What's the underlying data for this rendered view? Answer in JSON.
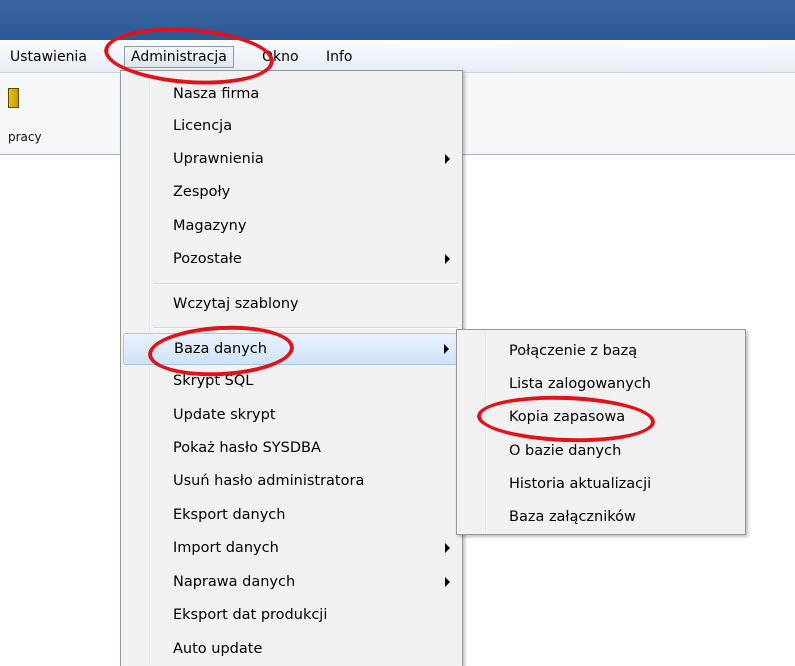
{
  "menubar": {
    "items": [
      {
        "label": "Ustawienia"
      },
      {
        "label": "Administracja"
      },
      {
        "label": "Okno"
      },
      {
        "label": "Info"
      }
    ]
  },
  "toolbar": {
    "item_label": "pracy"
  },
  "admin_menu": {
    "items": [
      {
        "label": "Nasza firma",
        "submenu": false
      },
      {
        "label": "Licencja",
        "submenu": false
      },
      {
        "label": "Uprawnienia",
        "submenu": true
      },
      {
        "label": "Zespoły",
        "submenu": false
      },
      {
        "label": "Magazyny",
        "submenu": false
      },
      {
        "label": "Pozostałe",
        "submenu": true
      },
      {
        "label": "Wczytaj szablony",
        "submenu": false
      },
      {
        "label": "Baza danych",
        "submenu": true,
        "highlighted": true
      },
      {
        "label": "Skrypt SQL",
        "submenu": false
      },
      {
        "label": "Update skrypt",
        "submenu": false
      },
      {
        "label": "Pokaż hasło SYSDBA",
        "submenu": false
      },
      {
        "label": "Usuń hasło administratora",
        "submenu": false
      },
      {
        "label": "Eksport danych",
        "submenu": false
      },
      {
        "label": "Import danych",
        "submenu": true
      },
      {
        "label": "Naprawa danych",
        "submenu": true
      },
      {
        "label": "Eksport dat produkcji",
        "submenu": false
      },
      {
        "label": "Auto update",
        "submenu": false
      }
    ]
  },
  "db_menu": {
    "items": [
      {
        "label": "Połączenie z bazą"
      },
      {
        "label": "Lista zalogowanych"
      },
      {
        "label": "Kopia zapasowa"
      },
      {
        "label": "O bazie danych"
      },
      {
        "label": "Historia aktualizacji"
      },
      {
        "label": "Baza załączników"
      }
    ]
  },
  "colors": {
    "titlebar": "#2d5a96",
    "highlight": "#cfe2f7",
    "annotation_ring": "#e0131b"
  }
}
